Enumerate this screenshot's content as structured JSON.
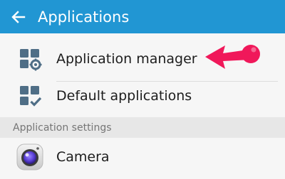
{
  "header": {
    "back_icon": "back-arrow-icon",
    "title": "Applications",
    "color": "#2196d3"
  },
  "items": [
    {
      "label": "Application manager",
      "icon": "apps-gear-icon"
    },
    {
      "label": "Default applications",
      "icon": "apps-check-icon"
    }
  ],
  "section": {
    "label": "Application settings"
  },
  "settings_items": [
    {
      "label": "Camera",
      "icon": "camera-icon"
    }
  ],
  "annotation": {
    "icon": "pointer-arrow-icon",
    "color": "#f0185a"
  }
}
